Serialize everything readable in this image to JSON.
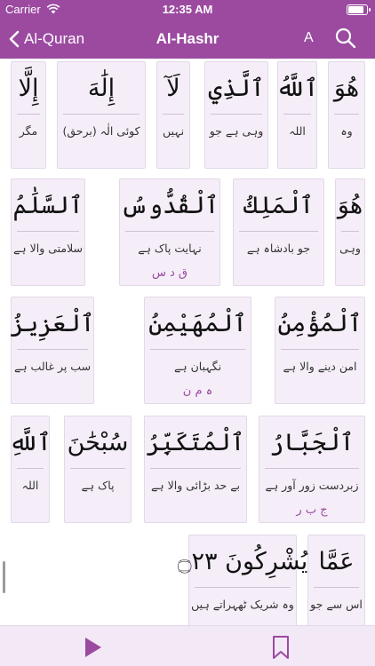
{
  "status_bar": {
    "carrier": "Carrier",
    "time": "12:35 AM",
    "battery_level": 0.9
  },
  "nav": {
    "back_label": "Al-Quran",
    "title": "Al-Hashr",
    "font_button": "A"
  },
  "rows": [
    [
      {
        "arabic": "هُوَ",
        "urdu": "وہ",
        "root": ""
      },
      {
        "arabic": "ٱللَّهُ",
        "urdu": "اللہ",
        "root": ""
      },
      {
        "arabic": "ٱلَّذِي",
        "urdu": "وہی ہے جو",
        "root": ""
      },
      {
        "arabic": "لَآ",
        "urdu": "نہیں",
        "root": ""
      },
      {
        "arabic": "إِلَٰهَ",
        "urdu": "کوئی الٰہ (برحق)",
        "root": ""
      },
      {
        "arabic": "إِلَّا",
        "urdu": "مگر",
        "root": ""
      }
    ],
    [
      {
        "arabic": "هُوَ",
        "urdu": "وہی",
        "root": ""
      },
      {
        "arabic": "ٱلْمَلِكُ",
        "urdu": "جو بادشاہ ہے",
        "root": ""
      },
      {
        "arabic": "ٱلْقُدُّوسُ",
        "urdu": "نہایت پاک ہے",
        "root": "ق د س"
      },
      {
        "arabic": "ٱلسَّلَٰمُ",
        "urdu": "سلامتی والا ہے",
        "root": ""
      }
    ],
    [
      {
        "arabic": "ٱلْمُؤْمِنُ",
        "urdu": "امن دینے والا ہے",
        "root": ""
      },
      {
        "arabic": "ٱلْمُهَيْمِنُ",
        "urdu": "نگہبان ہے",
        "root": "ہ م ن"
      },
      {
        "arabic": "ٱلْعَزِيزُ",
        "urdu": "سب پر غالب ہے",
        "root": ""
      }
    ],
    [
      {
        "arabic": "ٱلْجَبَّارُ",
        "urdu": "زبردست زور آور ہے",
        "root": "ج ب ر"
      },
      {
        "arabic": "ٱلْمُتَكَبِّرُ",
        "urdu": "بے حد بڑائی والا ہے",
        "root": ""
      },
      {
        "arabic": "سُبْحَٰنَ",
        "urdu": "پاک ہے",
        "root": ""
      },
      {
        "arabic": "ٱللَّهِ",
        "urdu": "اللہ",
        "root": ""
      }
    ],
    [
      {
        "arabic": "عَمَّا",
        "urdu": "اس سے جو",
        "root": ""
      },
      {
        "arabic": "يُشْرِكُونَ ۝٢٣",
        "urdu": "وہ شریک ٹھہراتے ہیں",
        "root": ""
      }
    ]
  ],
  "icons": {
    "back": "chevron-left-icon",
    "search": "search-icon",
    "play": "play-icon",
    "bookmark": "bookmark-icon"
  },
  "colors": {
    "accent": "#9b4aa0",
    "card_bg": "#f5eef8",
    "root_text": "#9b4aa0",
    "bottom_bar": "#f3e9f6"
  }
}
